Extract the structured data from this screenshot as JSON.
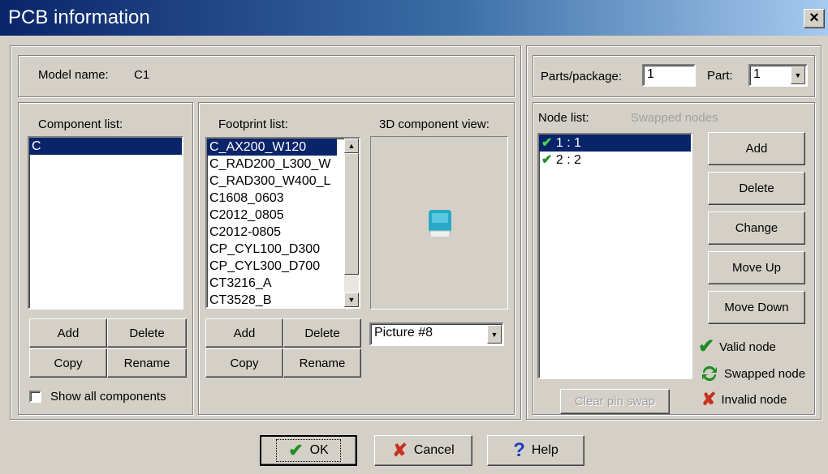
{
  "window": {
    "title": "PCB information",
    "close_label": "×"
  },
  "model": {
    "label": "Model name:",
    "value": "C1"
  },
  "component_list": {
    "label": "Component list:",
    "items": [
      "C"
    ],
    "buttons": {
      "add": "Add",
      "delete": "Delete",
      "copy": "Copy",
      "rename": "Rename"
    },
    "show_all_label": "Show all components"
  },
  "footprint_list": {
    "label": "Footprint list:",
    "items": [
      "C_AX200_W120",
      "C_RAD200_L300_W",
      "C_RAD300_W400_L",
      "C1608_0603",
      "C2012_0805",
      "C2012-0805",
      "CP_CYL100_D300",
      "CP_CYL300_D700",
      "CT3216_A",
      "CT3528_B"
    ],
    "buttons": {
      "add": "Add",
      "delete": "Delete",
      "copy": "Copy",
      "rename": "Rename"
    }
  },
  "component_view": {
    "label": "3D component view:",
    "picture": "Picture #8"
  },
  "parts": {
    "parts_label": "Parts/package:",
    "parts_value": "1",
    "part_label": "Part:",
    "part_value": "1"
  },
  "node_list": {
    "label": "Node list:",
    "swapped_label": "Swapped nodes",
    "items": [
      "1 : 1",
      "2 : 2"
    ],
    "buttons": {
      "add": "Add",
      "delete": "Delete",
      "change": "Change",
      "move_up": "Move Up",
      "move_down": "Move Down"
    },
    "clear_label": "Clear pin swap"
  },
  "legend": {
    "valid": "Valid node",
    "swapped": "Swapped node",
    "invalid": "Invalid node"
  },
  "footer": {
    "ok": "OK",
    "cancel": "Cancel",
    "help": "Help"
  },
  "colors": {
    "title_start": "#0a246a",
    "title_end": "#a6caf0",
    "selection": "#0a246a",
    "valid": "#1e8c1e",
    "invalid": "#c8321e"
  }
}
